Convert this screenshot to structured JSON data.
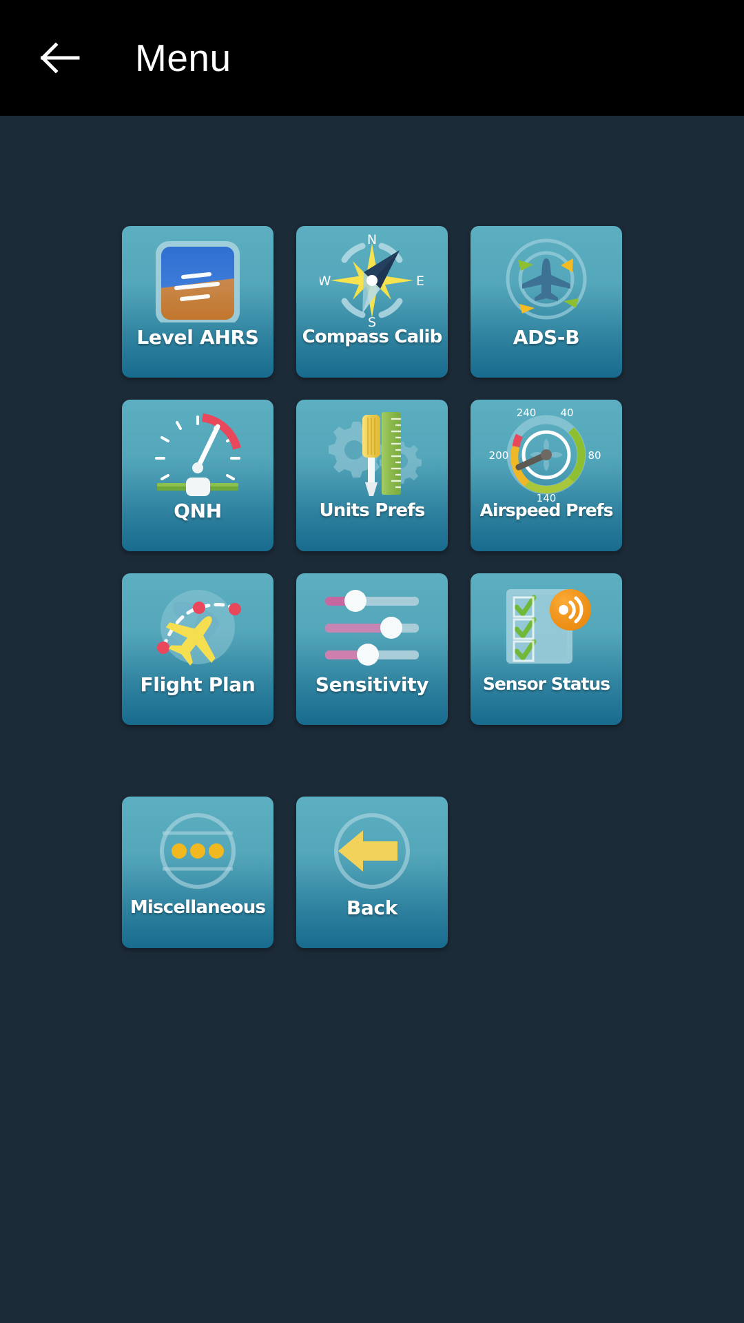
{
  "appbar": {
    "back_icon": "arrow-left-icon",
    "title": "Menu"
  },
  "background_color": "#1c2b38",
  "appbar_color": "#000000",
  "tile_gradient_top": "#5cafc0",
  "tile_gradient_bottom": "#186b8e",
  "tiles": [
    {
      "id": "level-ahrs",
      "label": "Level AHRS",
      "icon": "attitude-indicator-icon"
    },
    {
      "id": "compass-calib",
      "label": "Compass Calib",
      "icon": "compass-rose-icon"
    },
    {
      "id": "ads-b",
      "label": "ADS-B",
      "icon": "radar-traffic-icon"
    },
    {
      "id": "qnh",
      "label": "QNH",
      "icon": "altimeter-slider-icon"
    },
    {
      "id": "units-prefs",
      "label": "Units Prefs",
      "icon": "ruler-screwdriver-gears-icon"
    },
    {
      "id": "airspeed-prefs",
      "label": "Airspeed Prefs",
      "icon": "airspeed-gauge-icon"
    },
    {
      "id": "flight-plan",
      "label": "Flight Plan",
      "icon": "globe-route-plane-icon"
    },
    {
      "id": "sensitivity",
      "label": "Sensitivity",
      "icon": "sliders-icon"
    },
    {
      "id": "sensor-status",
      "label": "Sensor Status",
      "icon": "checklist-signal-icon"
    },
    {
      "id": "miscellaneous",
      "label": "Miscellaneous",
      "icon": "ellipsis-circle-icon"
    },
    {
      "id": "back",
      "label": "Back",
      "icon": "arrow-left-big-icon"
    }
  ],
  "icon_values": {
    "compass_cardinals": {
      "n": "N",
      "e": "E",
      "s": "S",
      "w": "W"
    },
    "airspeed_gauge_ticks": [
      "240",
      "40",
      "200",
      "80",
      "140"
    ]
  }
}
